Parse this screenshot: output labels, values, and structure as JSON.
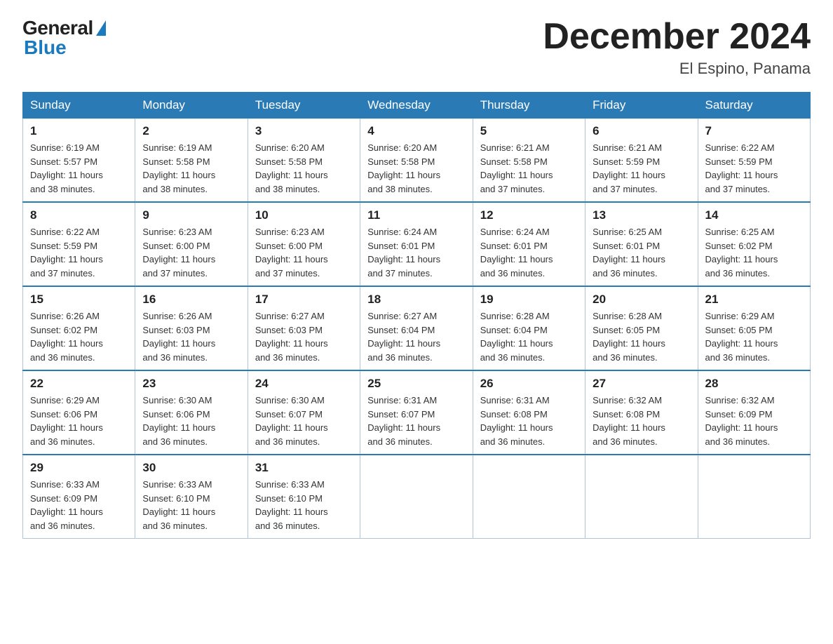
{
  "logo": {
    "general": "General",
    "blue": "Blue"
  },
  "title": "December 2024",
  "location": "El Espino, Panama",
  "weekdays": [
    "Sunday",
    "Monday",
    "Tuesday",
    "Wednesday",
    "Thursday",
    "Friday",
    "Saturday"
  ],
  "weeks": [
    [
      {
        "day": "1",
        "sunrise": "6:19 AM",
        "sunset": "5:57 PM",
        "daylight": "11 hours and 38 minutes."
      },
      {
        "day": "2",
        "sunrise": "6:19 AM",
        "sunset": "5:58 PM",
        "daylight": "11 hours and 38 minutes."
      },
      {
        "day": "3",
        "sunrise": "6:20 AM",
        "sunset": "5:58 PM",
        "daylight": "11 hours and 38 minutes."
      },
      {
        "day": "4",
        "sunrise": "6:20 AM",
        "sunset": "5:58 PM",
        "daylight": "11 hours and 38 minutes."
      },
      {
        "day": "5",
        "sunrise": "6:21 AM",
        "sunset": "5:58 PM",
        "daylight": "11 hours and 37 minutes."
      },
      {
        "day": "6",
        "sunrise": "6:21 AM",
        "sunset": "5:59 PM",
        "daylight": "11 hours and 37 minutes."
      },
      {
        "day": "7",
        "sunrise": "6:22 AM",
        "sunset": "5:59 PM",
        "daylight": "11 hours and 37 minutes."
      }
    ],
    [
      {
        "day": "8",
        "sunrise": "6:22 AM",
        "sunset": "5:59 PM",
        "daylight": "11 hours and 37 minutes."
      },
      {
        "day": "9",
        "sunrise": "6:23 AM",
        "sunset": "6:00 PM",
        "daylight": "11 hours and 37 minutes."
      },
      {
        "day": "10",
        "sunrise": "6:23 AM",
        "sunset": "6:00 PM",
        "daylight": "11 hours and 37 minutes."
      },
      {
        "day": "11",
        "sunrise": "6:24 AM",
        "sunset": "6:01 PM",
        "daylight": "11 hours and 37 minutes."
      },
      {
        "day": "12",
        "sunrise": "6:24 AM",
        "sunset": "6:01 PM",
        "daylight": "11 hours and 36 minutes."
      },
      {
        "day": "13",
        "sunrise": "6:25 AM",
        "sunset": "6:01 PM",
        "daylight": "11 hours and 36 minutes."
      },
      {
        "day": "14",
        "sunrise": "6:25 AM",
        "sunset": "6:02 PM",
        "daylight": "11 hours and 36 minutes."
      }
    ],
    [
      {
        "day": "15",
        "sunrise": "6:26 AM",
        "sunset": "6:02 PM",
        "daylight": "11 hours and 36 minutes."
      },
      {
        "day": "16",
        "sunrise": "6:26 AM",
        "sunset": "6:03 PM",
        "daylight": "11 hours and 36 minutes."
      },
      {
        "day": "17",
        "sunrise": "6:27 AM",
        "sunset": "6:03 PM",
        "daylight": "11 hours and 36 minutes."
      },
      {
        "day": "18",
        "sunrise": "6:27 AM",
        "sunset": "6:04 PM",
        "daylight": "11 hours and 36 minutes."
      },
      {
        "day": "19",
        "sunrise": "6:28 AM",
        "sunset": "6:04 PM",
        "daylight": "11 hours and 36 minutes."
      },
      {
        "day": "20",
        "sunrise": "6:28 AM",
        "sunset": "6:05 PM",
        "daylight": "11 hours and 36 minutes."
      },
      {
        "day": "21",
        "sunrise": "6:29 AM",
        "sunset": "6:05 PM",
        "daylight": "11 hours and 36 minutes."
      }
    ],
    [
      {
        "day": "22",
        "sunrise": "6:29 AM",
        "sunset": "6:06 PM",
        "daylight": "11 hours and 36 minutes."
      },
      {
        "day": "23",
        "sunrise": "6:30 AM",
        "sunset": "6:06 PM",
        "daylight": "11 hours and 36 minutes."
      },
      {
        "day": "24",
        "sunrise": "6:30 AM",
        "sunset": "6:07 PM",
        "daylight": "11 hours and 36 minutes."
      },
      {
        "day": "25",
        "sunrise": "6:31 AM",
        "sunset": "6:07 PM",
        "daylight": "11 hours and 36 minutes."
      },
      {
        "day": "26",
        "sunrise": "6:31 AM",
        "sunset": "6:08 PM",
        "daylight": "11 hours and 36 minutes."
      },
      {
        "day": "27",
        "sunrise": "6:32 AM",
        "sunset": "6:08 PM",
        "daylight": "11 hours and 36 minutes."
      },
      {
        "day": "28",
        "sunrise": "6:32 AM",
        "sunset": "6:09 PM",
        "daylight": "11 hours and 36 minutes."
      }
    ],
    [
      {
        "day": "29",
        "sunrise": "6:33 AM",
        "sunset": "6:09 PM",
        "daylight": "11 hours and 36 minutes."
      },
      {
        "day": "30",
        "sunrise": "6:33 AM",
        "sunset": "6:10 PM",
        "daylight": "11 hours and 36 minutes."
      },
      {
        "day": "31",
        "sunrise": "6:33 AM",
        "sunset": "6:10 PM",
        "daylight": "11 hours and 36 minutes."
      },
      null,
      null,
      null,
      null
    ]
  ],
  "labels": {
    "sunrise": "Sunrise:",
    "sunset": "Sunset:",
    "daylight": "Daylight:"
  }
}
